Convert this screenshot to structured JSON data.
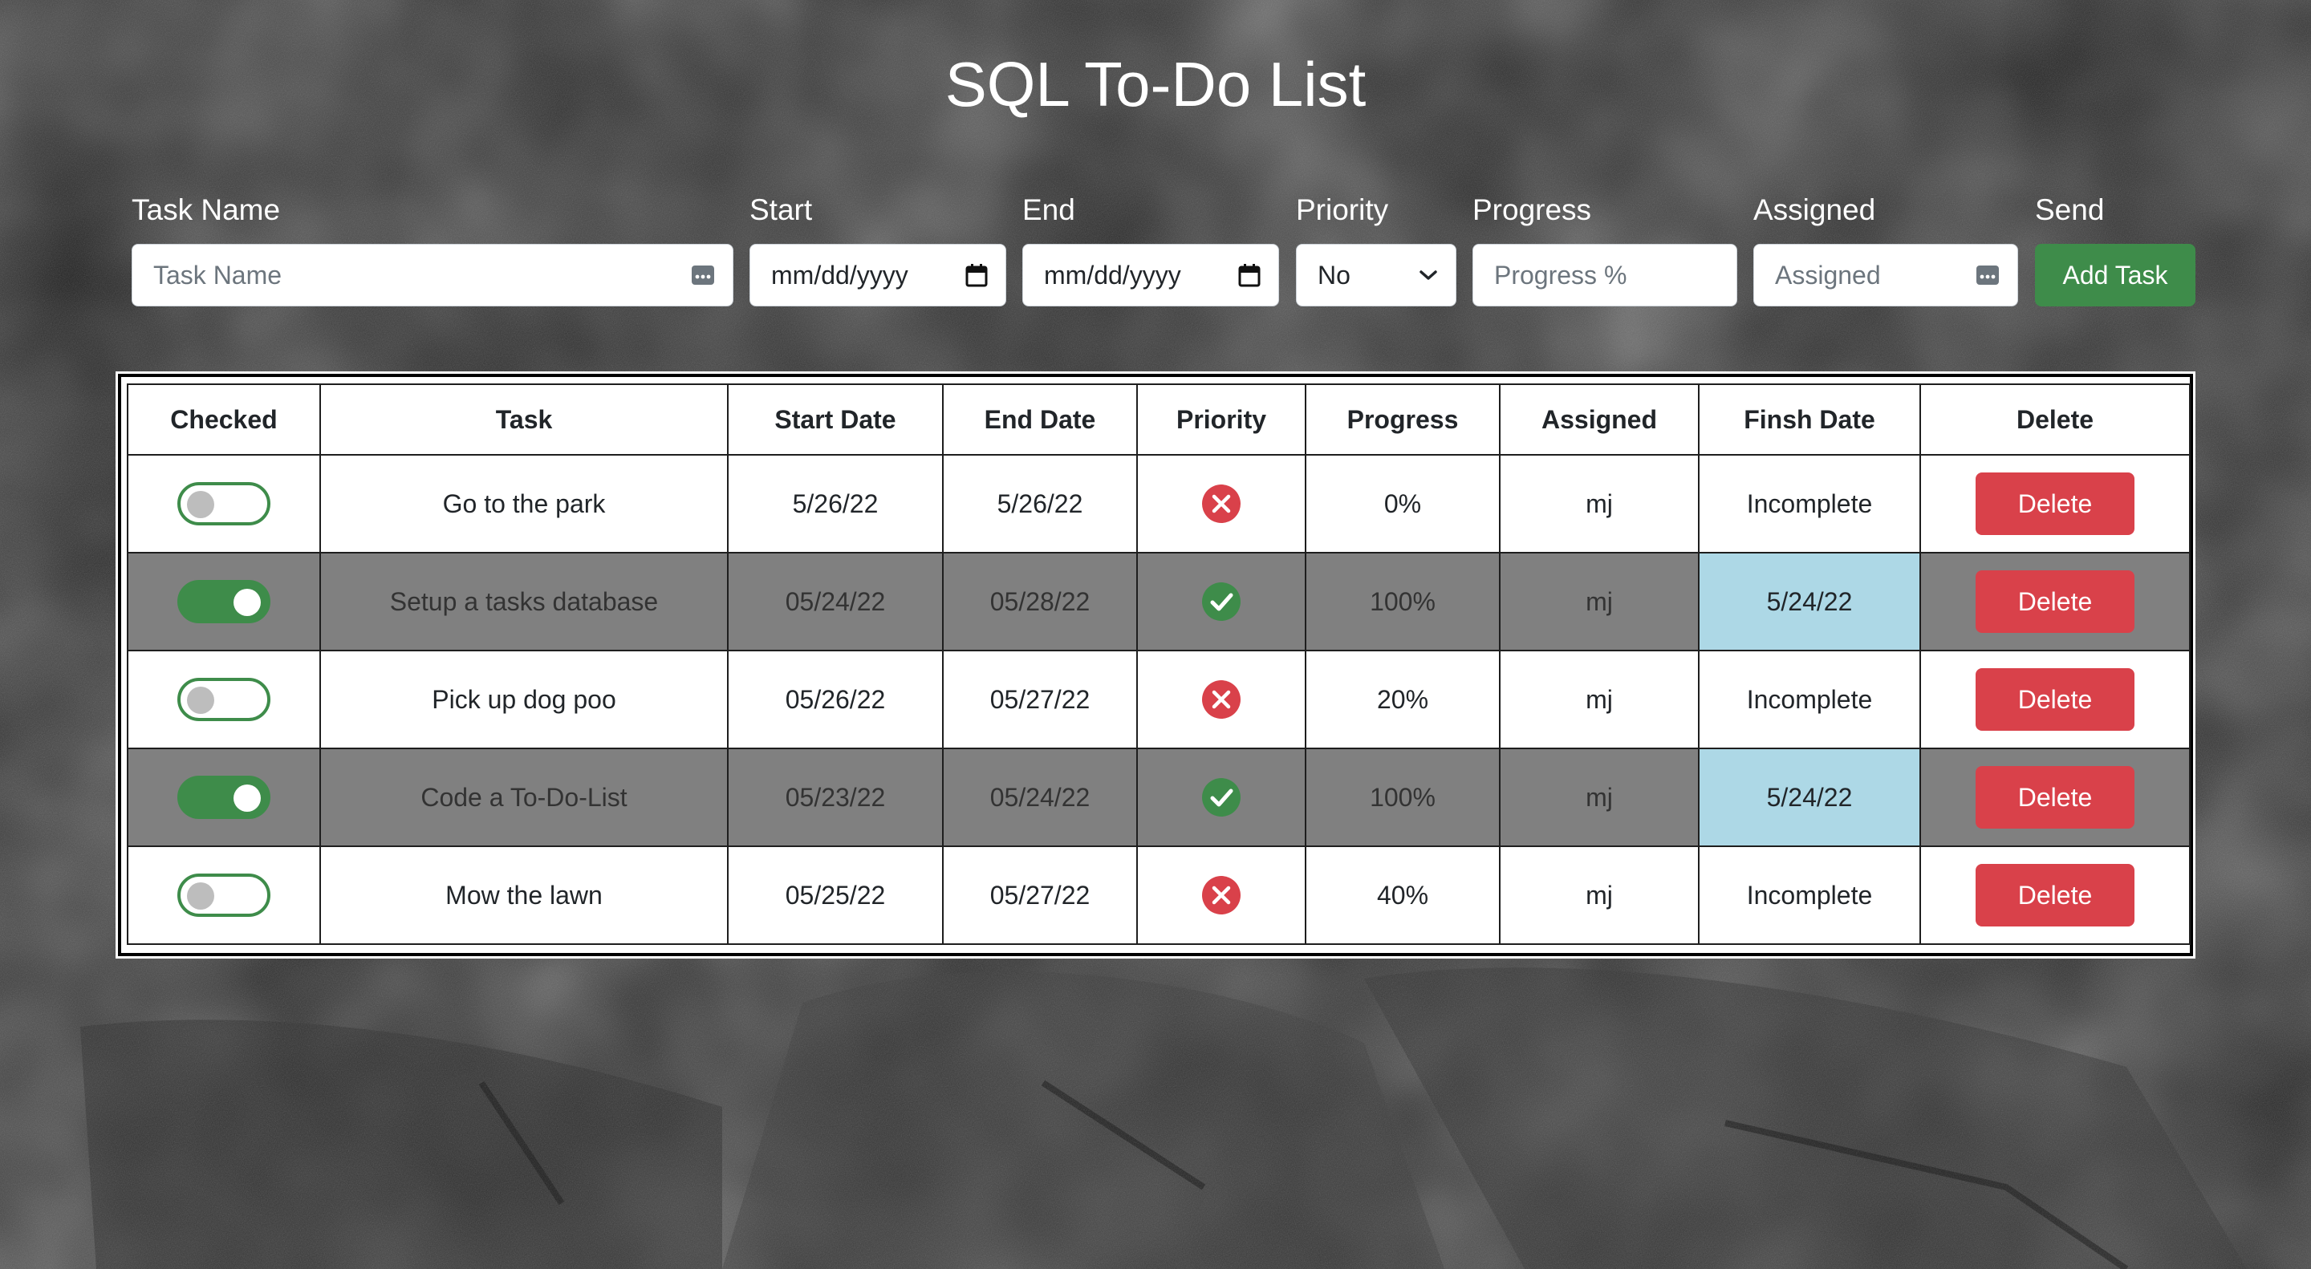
{
  "title": "SQL To-Do List",
  "form": {
    "task_name": {
      "label": "Task Name",
      "placeholder": "Task Name"
    },
    "start": {
      "label": "Start",
      "value": "mm/dd/yyyy"
    },
    "end": {
      "label": "End",
      "value": "mm/dd/yyyy"
    },
    "priority": {
      "label": "Priority",
      "value": "No"
    },
    "progress": {
      "label": "Progress",
      "placeholder": "Progress %"
    },
    "assigned": {
      "label": "Assigned",
      "placeholder": "Assigned"
    },
    "send": {
      "label": "Send",
      "button": "Add Task"
    }
  },
  "table": {
    "headers": [
      "Checked",
      "Task",
      "Start Date",
      "End Date",
      "Priority",
      "Progress",
      "Assigned",
      "Finsh Date",
      "Delete"
    ],
    "rows": [
      {
        "checked": false,
        "task": "Go to the park",
        "start": "5/26/22",
        "end": "5/26/22",
        "priority": "x-icon",
        "progress": "0%",
        "assigned": "mj",
        "finish": "Incomplete",
        "delete": "Delete"
      },
      {
        "checked": true,
        "task": "Setup a tasks database",
        "start": "05/24/22",
        "end": "05/28/22",
        "priority": "check-icon",
        "progress": "100%",
        "assigned": "mj",
        "finish": "5/24/22",
        "delete": "Delete"
      },
      {
        "checked": false,
        "task": "Pick up dog poo",
        "start": "05/26/22",
        "end": "05/27/22",
        "priority": "x-icon",
        "progress": "20%",
        "assigned": "mj",
        "finish": "Incomplete",
        "delete": "Delete"
      },
      {
        "checked": true,
        "task": "Code a To-Do-List",
        "start": "05/23/22",
        "end": "05/24/22",
        "priority": "check-icon",
        "progress": "100%",
        "assigned": "mj",
        "finish": "5/24/22",
        "delete": "Delete"
      },
      {
        "checked": false,
        "task": "Mow the lawn",
        "start": "05/25/22",
        "end": "05/27/22",
        "priority": "x-icon",
        "progress": "40%",
        "assigned": "mj",
        "finish": "Incomplete",
        "delete": "Delete"
      }
    ]
  },
  "colors": {
    "success": "#3e8c4a",
    "danger": "#d9414a",
    "done_row": "#808080",
    "finish_cell": "#add8e6",
    "x_icon": "#d9414a",
    "check_icon": "#3e8c4a"
  }
}
